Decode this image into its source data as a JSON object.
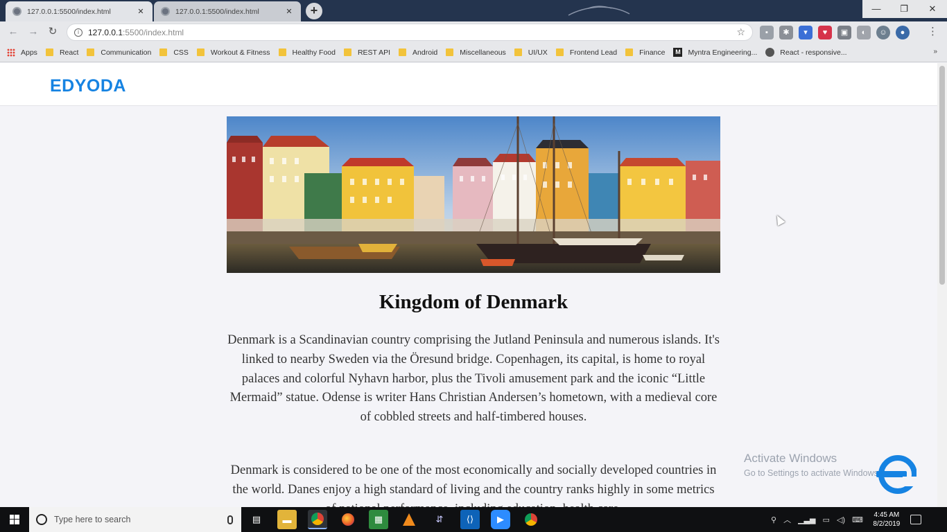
{
  "browser": {
    "tabs": [
      {
        "title": "127.0.0.1:5500/index.html",
        "active": true
      },
      {
        "title": "127.0.0.1:5500/index.html",
        "active": false
      }
    ],
    "url_host": "127.0.0.1",
    "url_path": ":5500/index.html",
    "bookmarks": [
      {
        "label": "Apps",
        "icon": "apps-grid-icon"
      },
      {
        "label": "React",
        "icon": "folder-icon"
      },
      {
        "label": "Communication",
        "icon": "folder-icon"
      },
      {
        "label": "CSS",
        "icon": "folder-icon"
      },
      {
        "label": "Workout & Fitness",
        "icon": "folder-icon"
      },
      {
        "label": "Healthy Food",
        "icon": "folder-icon"
      },
      {
        "label": "REST API",
        "icon": "folder-icon"
      },
      {
        "label": "Android",
        "icon": "folder-icon"
      },
      {
        "label": "Miscellaneous",
        "icon": "folder-icon"
      },
      {
        "label": "UI/UX",
        "icon": "folder-icon"
      },
      {
        "label": "Frontend Lead",
        "icon": "folder-icon"
      },
      {
        "label": "Finance",
        "icon": "folder-icon"
      },
      {
        "label": "Myntra Engineering...",
        "icon": "myntra-icon"
      },
      {
        "label": "React - responsive...",
        "icon": "globe-icon"
      }
    ],
    "bookmarks_more": "»"
  },
  "page": {
    "logo": "EDYODA",
    "title": "Kingdom of Denmark",
    "paragraphs": [
      "Denmark is a Scandinavian country comprising the Jutland Peninsula and numerous islands. It's linked to nearby Sweden via the Öresund bridge. Copenhagen, its capital, is home to royal palaces and colorful Nyhavn harbor, plus the Tivoli amusement park and the iconic “Little Mermaid” statue. Odense is writer Hans Christian Andersen’s hometown, with a medieval core of cobbled streets and half-timbered houses.",
      "Denmark is considered to be one of the most economically and socially developed countries in the world. Danes enjoy a high standard of living and the country ranks highly in some metrics of national performance, including education, health care,"
    ],
    "accent_color": "#1683e2"
  },
  "overlay": {
    "activate_title": "Activate Windows",
    "activate_sub": "Go to Settings to activate Windows."
  },
  "taskbar": {
    "search_placeholder": "Type here to search",
    "time": "4:45 AM",
    "date": "8/2/2019"
  }
}
